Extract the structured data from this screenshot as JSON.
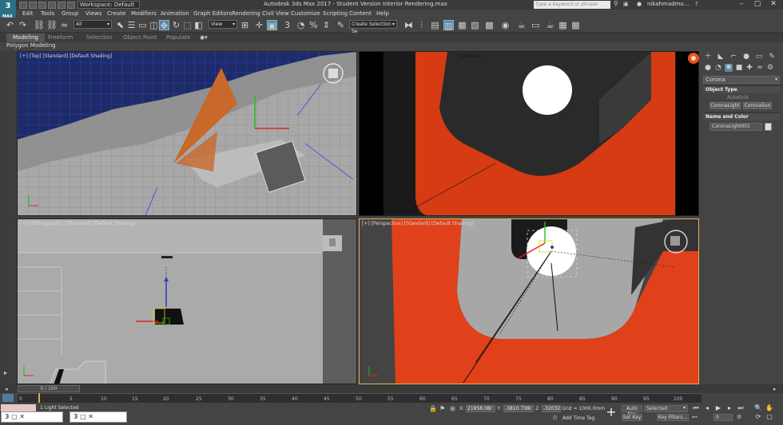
{
  "app": {
    "title": "Autodesk 3ds Max 2017 - Student Version    Interior Rendering.max",
    "logo": "3",
    "logo_sub": "MAX",
    "workspace": "Workspace: Default",
    "search_placeholder": "Type a keyword or phrase",
    "user": "nikahmadmu..."
  },
  "menu": [
    "Edit",
    "Tools",
    "Group",
    "Views",
    "Create",
    "Modifiers",
    "Animation",
    "Graph Editors",
    "Rendering",
    "Civil View",
    "Customize",
    "Scripting",
    "Content",
    "Help"
  ],
  "toolbar": {
    "filter_dropdown": "All",
    "refcoord_dropdown": "View",
    "selection_set": "Create Selection Se"
  },
  "ribbon": {
    "tabs": [
      "Modeling",
      "Freeform",
      "Selection",
      "Object Paint",
      "Populate"
    ],
    "active": "Modeling",
    "panel_label": "Polygon Modeling"
  },
  "viewports": {
    "top": "[+] [Top] [Standard] [Default Shading]",
    "camera": "Corona...",
    "ortho": "[+] [Orthographic] [Standard] [Default Shading]",
    "persp": "[+] [Perspective] [Standard] [Default Shading]"
  },
  "command_panel": {
    "dropdown": "Corona",
    "object_type_title": "Object Type",
    "autogrid": "AutoGrid",
    "buttons": [
      "CoronaLight",
      "CoronaSun"
    ],
    "name_color_title": "Name and Color",
    "object_name": "CoronaLight001"
  },
  "timeline": {
    "slider": "0 / 100",
    "ticks": [
      "0",
      "5",
      "10",
      "15",
      "20",
      "25",
      "30",
      "35",
      "40",
      "45",
      "50",
      "55",
      "60",
      "65",
      "70",
      "75",
      "80",
      "85",
      "90",
      "95",
      "100"
    ]
  },
  "status": {
    "selection": "1 Light Selected",
    "x_label": "X:",
    "x": "21958.08r",
    "y_label": "Y:",
    "y": "-3810.738r",
    "z_label": "Z:",
    "z": "-32032.03r",
    "grid": "Grid = 1000.0mm",
    "add_time_tag": "Add Time Tag",
    "auto_key": "Auto Key",
    "set_key": "Set Key",
    "selected": "Selected",
    "key_filters": "Key Filters...",
    "frame": "0"
  },
  "taskbar_thumbs": [
    "",
    ""
  ],
  "colors": {
    "accent": "#5d87a1",
    "orange_surface": "#e0411a",
    "navy_ground": "#1d2b6b",
    "active_viewport_border": "#e0b050"
  }
}
